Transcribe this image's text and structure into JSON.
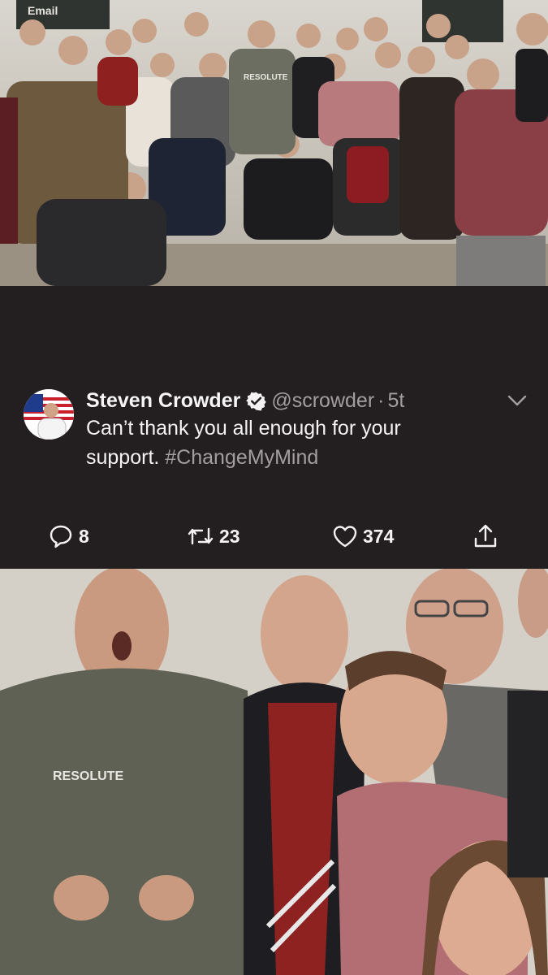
{
  "top_photo": {
    "chalkboard_text": "Email",
    "shirt_text": "RESOLUTE"
  },
  "tweet": {
    "author_name": "Steven Crowder",
    "verified": true,
    "handle": "@scrowder",
    "separator": "·",
    "timestamp": "5t",
    "text_line1": "Can’t thank you all enough for your",
    "text_line2_prefix": "support. ",
    "hashtag": "#ChangeMyMind",
    "reply_count": "8",
    "retweet_count": "23",
    "like_count": "374",
    "icons": {
      "reply": "reply-icon",
      "retweet": "retweet-icon",
      "like": "heart-icon",
      "share": "share-icon",
      "menu": "chevron-down-icon",
      "verified": "verified-badge-icon"
    }
  },
  "bottom_photo": {
    "shirt_text": "RESOLUTE"
  },
  "colors": {
    "background": "#231e20",
    "primary_text": "#f4f2f3",
    "secondary_text": "#a49ea0"
  }
}
